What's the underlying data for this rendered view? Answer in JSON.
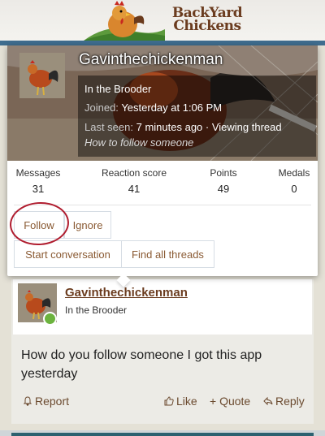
{
  "site": {
    "logo_line1": "BackYard",
    "logo_line2": "Chickens",
    "brand_brown": "#6b3c1f",
    "bar_blue": "#3f6d8f"
  },
  "member_card": {
    "username": "Gavinthechickenman",
    "user_title": "In the Brooder",
    "joined_label": "Joined:",
    "joined_value": "Yesterday at 1:06 PM",
    "last_seen_label": "Last seen:",
    "last_seen_value": "7 minutes ago · Viewing thread",
    "activity": "How to follow someone",
    "stats": [
      {
        "label": "Messages",
        "value": "31"
      },
      {
        "label": "Reaction score",
        "value": "41"
      },
      {
        "label": "Points",
        "value": "49"
      },
      {
        "label": "Medals",
        "value": "0"
      }
    ],
    "buttons": {
      "follow": "Follow",
      "ignore": "Ignore",
      "start_conversation": "Start conversation",
      "find_threads": "Find all threads"
    },
    "annotation_color": "#b01c2e"
  },
  "post": {
    "username": "Gavinthechickenman",
    "user_title": "In the Brooder",
    "body": "How do you follow someone I got this app yesterday",
    "actions": {
      "report": "Report",
      "like": "Like",
      "quote": "+ Quote",
      "reply": "Reply"
    },
    "online_color": "#6cb33e"
  }
}
